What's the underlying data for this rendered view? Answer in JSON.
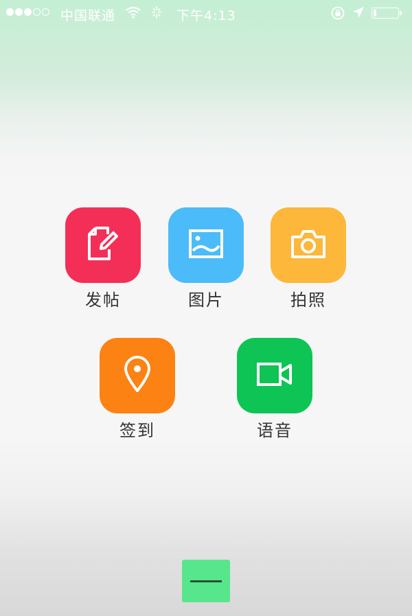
{
  "status_bar": {
    "signal_dots": [
      true,
      true,
      true,
      false,
      false
    ],
    "carrier": "中国联通",
    "time": "下午4:13",
    "battery_level": 0.12
  },
  "actions": [
    {
      "id": "post",
      "label": "发帖",
      "icon": "edit-document-icon",
      "color": "#f42f57"
    },
    {
      "id": "image",
      "label": "图片",
      "icon": "image-icon",
      "color": "#4cbbf9"
    },
    {
      "id": "photo",
      "label": "拍照",
      "icon": "camera-icon",
      "color": "#fdb73b"
    },
    {
      "id": "checkin",
      "label": "签到",
      "icon": "location-pin-icon",
      "color": "#fb8213"
    },
    {
      "id": "voice",
      "label": "语音",
      "icon": "video-camera-icon",
      "color": "#0ec455"
    }
  ],
  "close_button": {
    "icon": "minus-icon",
    "color": "#58e68c"
  }
}
